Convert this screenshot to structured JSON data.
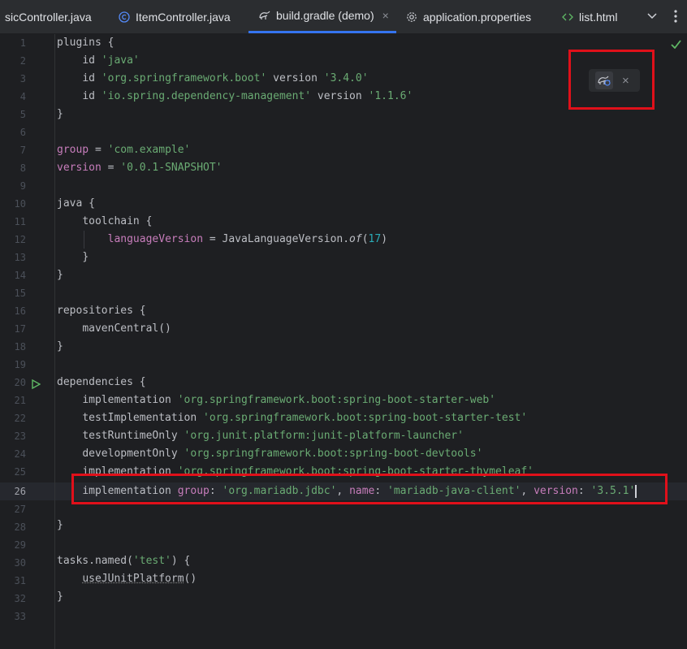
{
  "tabs": [
    {
      "label": "sicController.java",
      "icon": "java-class-icon"
    },
    {
      "label": "ItemController.java",
      "icon": "java-class-icon"
    },
    {
      "label": "build.gradle (demo)",
      "icon": "gradle-icon",
      "active": true
    },
    {
      "label": "application.properties",
      "icon": "settings-gear-icon"
    },
    {
      "label": "list.html",
      "icon": "html-code-icon"
    }
  ],
  "tab_more_icon": "chevron-down-icon",
  "tab_close_glyph": "×",
  "widget": {
    "icon": "gradle-reload-icon",
    "close": "×"
  },
  "status_icon": "inspection-ok-checkmark-icon",
  "line_numbers": [
    "1",
    "2",
    "3",
    "4",
    "5",
    "6",
    "7",
    "8",
    "9",
    "10",
    "11",
    "12",
    "13",
    "14",
    "15",
    "16",
    "17",
    "18",
    "19",
    "20",
    "21",
    "22",
    "23",
    "24",
    "25",
    "26",
    "27",
    "28",
    "29",
    "30",
    "31",
    "32",
    "33"
  ],
  "current_line": 26,
  "code": {
    "l1": [
      "plugins {"
    ],
    "l2": [
      "id ",
      "'java'"
    ],
    "l3": [
      "id ",
      "'org.springframework.boot'",
      " version ",
      "'3.4.0'"
    ],
    "l4": [
      "id ",
      "'io.spring.dependency-management'",
      " version ",
      "'1.1.6'"
    ],
    "l5": [
      "}"
    ],
    "l7": [
      "group",
      " = ",
      "'com.example'"
    ],
    "l8": [
      "version",
      " = ",
      "'0.0.1-SNAPSHOT'"
    ],
    "l10": [
      "java {"
    ],
    "l11": [
      "toolchain {"
    ],
    "l12": [
      "languageVersion",
      " = JavaLanguageVersion.",
      "of",
      "(",
      "17",
      ")"
    ],
    "l13": [
      "}"
    ],
    "l14": [
      "}"
    ],
    "l16": [
      "repositories {"
    ],
    "l17": [
      "mavenCentral()"
    ],
    "l18": [
      "}"
    ],
    "l20": [
      "dependencies {"
    ],
    "l21": [
      "implementation ",
      "'org.springframework.boot:spring-boot-starter-web'"
    ],
    "l22": [
      "testImplementation ",
      "'org.springframework.boot:spring-boot-starter-test'"
    ],
    "l23": [
      "testRuntimeOnly ",
      "'org.junit.platform:junit-platform-launcher'"
    ],
    "l24": [
      "developmentOnly ",
      "'org.springframework.boot:spring-boot-devtools'"
    ],
    "l25": [
      "implementation ",
      "'org.springframework.boot:spring-boot-starter-thymeleaf'"
    ],
    "l26": [
      "implementation ",
      "group",
      ": ",
      "'org.mariadb.jdbc'",
      ", ",
      "name",
      ": ",
      "'mariadb-java-client'",
      ", ",
      "version",
      ": ",
      "'3.5.1'"
    ],
    "l28": [
      "}"
    ],
    "l30": [
      "tasks.named(",
      "'test'",
      ") {"
    ],
    "l31": [
      "useJUnitPlatform",
      "()"
    ],
    "l32": [
      "}"
    ]
  },
  "colors": {
    "accent_tab_underline": "#3574f0",
    "string": "#6aab73",
    "property": "#c77dbb",
    "number": "#2aacb8",
    "highlight_box": "#e0101a",
    "run_gutter_icon": "#5fb865"
  }
}
